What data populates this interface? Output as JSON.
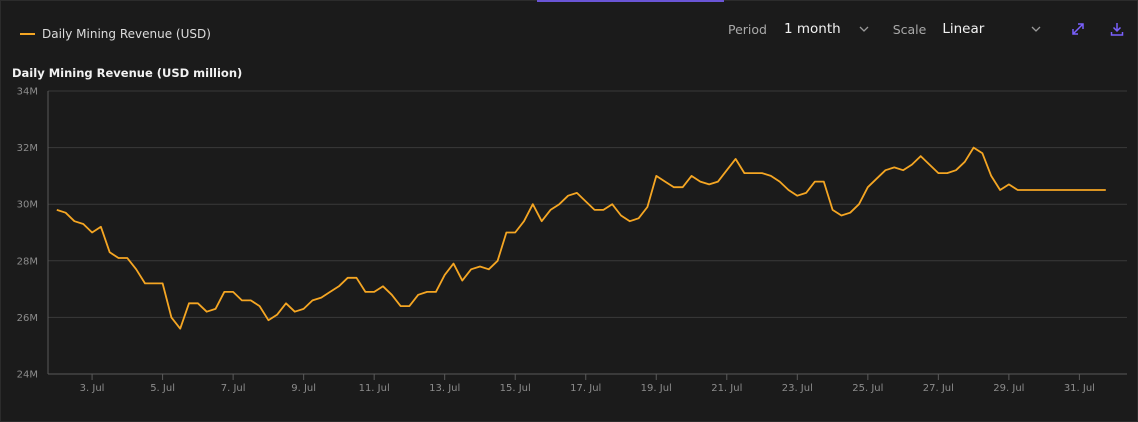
{
  "legend": {
    "label": "Daily Mining Revenue (USD)",
    "color": "#f5a623"
  },
  "controls": {
    "period_label": "Period",
    "period_value": "1 month",
    "scale_label": "Scale",
    "scale_value": "Linear",
    "expand_icon": "expand-diagonal-icon",
    "download_icon": "download-icon",
    "accent_color": "#7b61ff"
  },
  "chart_data": {
    "type": "line",
    "title": "Daily Mining Revenue (USD million)",
    "xlabel": "",
    "ylabel": "",
    "ylim": [
      24,
      34
    ],
    "y_ticks": [
      24,
      26,
      28,
      30,
      32,
      34
    ],
    "y_tick_labels": [
      "24M",
      "26M",
      "28M",
      "30M",
      "32M",
      "34M"
    ],
    "x_range": [
      1.75,
      32.35
    ],
    "x_ticks": [
      3,
      5,
      7,
      9,
      11,
      13,
      15,
      17,
      19,
      21,
      23,
      25,
      27,
      29,
      31
    ],
    "x_tick_labels": [
      "3. Jul",
      "5. Jul",
      "7. Jul",
      "9. Jul",
      "11. Jul",
      "13. Jul",
      "15. Jul",
      "17. Jul",
      "19. Jul",
      "21. Jul",
      "23. Jul",
      "25. Jul",
      "27. Jul",
      "29. Jul",
      "31. Jul"
    ],
    "grid": true,
    "legend_position": "top-left",
    "series": [
      {
        "name": "Daily Mining Revenue (USD)",
        "color": "#f5a623",
        "x": [
          2.0,
          2.25,
          2.5,
          2.75,
          3.0,
          3.25,
          3.5,
          3.75,
          4.0,
          4.25,
          4.5,
          4.75,
          5.0,
          5.25,
          5.5,
          5.75,
          6.0,
          6.25,
          6.5,
          6.75,
          7.0,
          7.25,
          7.5,
          7.75,
          8.0,
          8.25,
          8.5,
          8.75,
          9.0,
          9.25,
          9.5,
          9.75,
          10.0,
          10.25,
          10.5,
          10.75,
          11.0,
          11.25,
          11.5,
          11.75,
          12.0,
          12.25,
          12.5,
          12.75,
          13.0,
          13.25,
          13.5,
          13.75,
          14.0,
          14.25,
          14.5,
          14.75,
          15.0,
          15.25,
          15.5,
          15.75,
          16.0,
          16.25,
          16.5,
          16.75,
          17.0,
          17.25,
          17.5,
          17.75,
          18.0,
          18.25,
          18.5,
          18.75,
          19.0,
          19.25,
          19.5,
          19.75,
          20.0,
          20.25,
          20.5,
          20.75,
          21.0,
          21.25,
          21.5,
          21.75,
          22.0,
          22.25,
          22.5,
          22.75,
          23.0,
          23.25,
          23.5,
          23.75,
          24.0,
          24.25,
          24.5,
          24.75,
          25.0,
          25.25,
          25.5,
          25.75,
          26.0,
          26.25,
          26.5,
          26.75,
          27.0,
          27.25,
          27.5,
          27.75,
          28.0,
          28.25,
          28.5,
          28.75,
          29.0,
          29.25,
          29.5,
          29.75,
          30.0,
          30.25,
          30.5,
          30.75,
          31.0,
          31.25,
          31.5,
          31.75
        ],
        "values": [
          29.8,
          29.7,
          29.4,
          29.3,
          29.0,
          29.2,
          28.3,
          28.1,
          28.1,
          27.7,
          27.2,
          27.2,
          27.2,
          26.0,
          25.6,
          26.5,
          26.5,
          26.2,
          26.3,
          26.9,
          26.9,
          26.6,
          26.6,
          26.4,
          25.9,
          26.1,
          26.5,
          26.2,
          26.3,
          26.6,
          26.7,
          26.9,
          27.1,
          27.4,
          27.4,
          26.9,
          26.9,
          27.1,
          26.8,
          26.4,
          26.4,
          26.8,
          26.9,
          26.9,
          27.5,
          27.9,
          27.3,
          27.7,
          27.8,
          27.7,
          28.0,
          29.0,
          29.0,
          29.4,
          30.0,
          29.4,
          29.8,
          30.0,
          30.3,
          30.4,
          30.1,
          29.8,
          29.8,
          30.0,
          29.6,
          29.4,
          29.5,
          29.9,
          31.0,
          30.8,
          30.6,
          30.6,
          31.0,
          30.8,
          30.7,
          30.8,
          31.2,
          31.6,
          31.1,
          31.1,
          31.1,
          31.0,
          30.8,
          30.5,
          30.3,
          30.4,
          30.8,
          30.8,
          29.8,
          29.6,
          29.7,
          30.0,
          30.6,
          30.9,
          31.2,
          31.3,
          31.2,
          31.4,
          31.7,
          31.4,
          31.1,
          31.1,
          31.2,
          31.5,
          32.0,
          31.8,
          31.0,
          30.5,
          30.7,
          30.5,
          30.5,
          30.5,
          30.5,
          30.5,
          30.5,
          30.5,
          30.5,
          30.5,
          30.5,
          30.5
        ]
      }
    ]
  }
}
